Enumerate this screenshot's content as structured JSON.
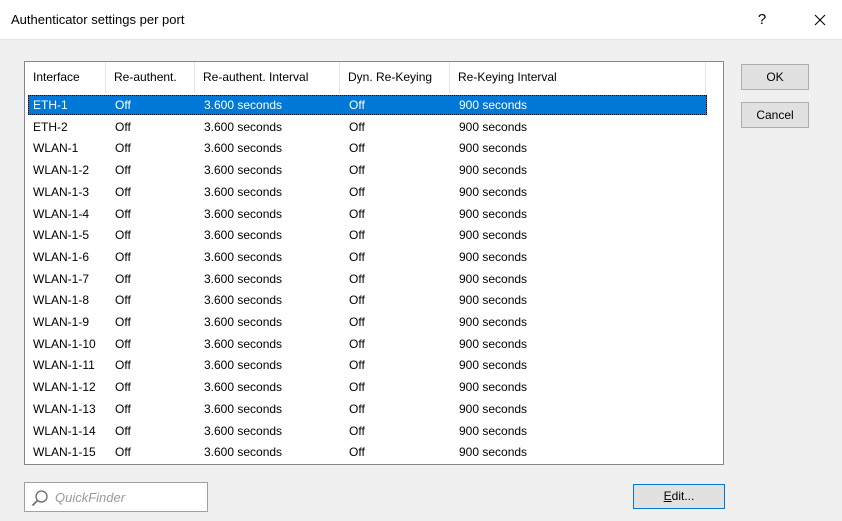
{
  "window": {
    "title": "Authenticator settings per port",
    "help_label": "?"
  },
  "table": {
    "columns": [
      "Interface",
      "Re-authent.",
      "Re-authent. Interval",
      "Dyn. Re-Keying",
      "Re-Keying Interval"
    ],
    "rows": [
      [
        "ETH-1",
        "Off",
        "3.600 seconds",
        "Off",
        "900 seconds"
      ],
      [
        "ETH-2",
        "Off",
        "3.600 seconds",
        "Off",
        "900 seconds"
      ],
      [
        "WLAN-1",
        "Off",
        "3.600 seconds",
        "Off",
        "900 seconds"
      ],
      [
        "WLAN-1-2",
        "Off",
        "3.600 seconds",
        "Off",
        "900 seconds"
      ],
      [
        "WLAN-1-3",
        "Off",
        "3.600 seconds",
        "Off",
        "900 seconds"
      ],
      [
        "WLAN-1-4",
        "Off",
        "3.600 seconds",
        "Off",
        "900 seconds"
      ],
      [
        "WLAN-1-5",
        "Off",
        "3.600 seconds",
        "Off",
        "900 seconds"
      ],
      [
        "WLAN-1-6",
        "Off",
        "3.600 seconds",
        "Off",
        "900 seconds"
      ],
      [
        "WLAN-1-7",
        "Off",
        "3.600 seconds",
        "Off",
        "900 seconds"
      ],
      [
        "WLAN-1-8",
        "Off",
        "3.600 seconds",
        "Off",
        "900 seconds"
      ],
      [
        "WLAN-1-9",
        "Off",
        "3.600 seconds",
        "Off",
        "900 seconds"
      ],
      [
        "WLAN-1-10",
        "Off",
        "3.600 seconds",
        "Off",
        "900 seconds"
      ],
      [
        "WLAN-1-11",
        "Off",
        "3.600 seconds",
        "Off",
        "900 seconds"
      ],
      [
        "WLAN-1-12",
        "Off",
        "3.600 seconds",
        "Off",
        "900 seconds"
      ],
      [
        "WLAN-1-13",
        "Off",
        "3.600 seconds",
        "Off",
        "900 seconds"
      ],
      [
        "WLAN-1-14",
        "Off",
        "3.600 seconds",
        "Off",
        "900 seconds"
      ],
      [
        "WLAN-1-15",
        "Off",
        "3.600 seconds",
        "Off",
        "900 seconds"
      ]
    ],
    "selected_row": "ETH-1",
    "selection_color": "#0078d7"
  },
  "buttons": {
    "ok_label": "OK",
    "cancel_label": "Cancel",
    "edit_label_first": "E",
    "edit_label_rest": "dit..."
  },
  "quickfinder": {
    "placeholder": "QuickFinder",
    "icon": "search-icon"
  }
}
